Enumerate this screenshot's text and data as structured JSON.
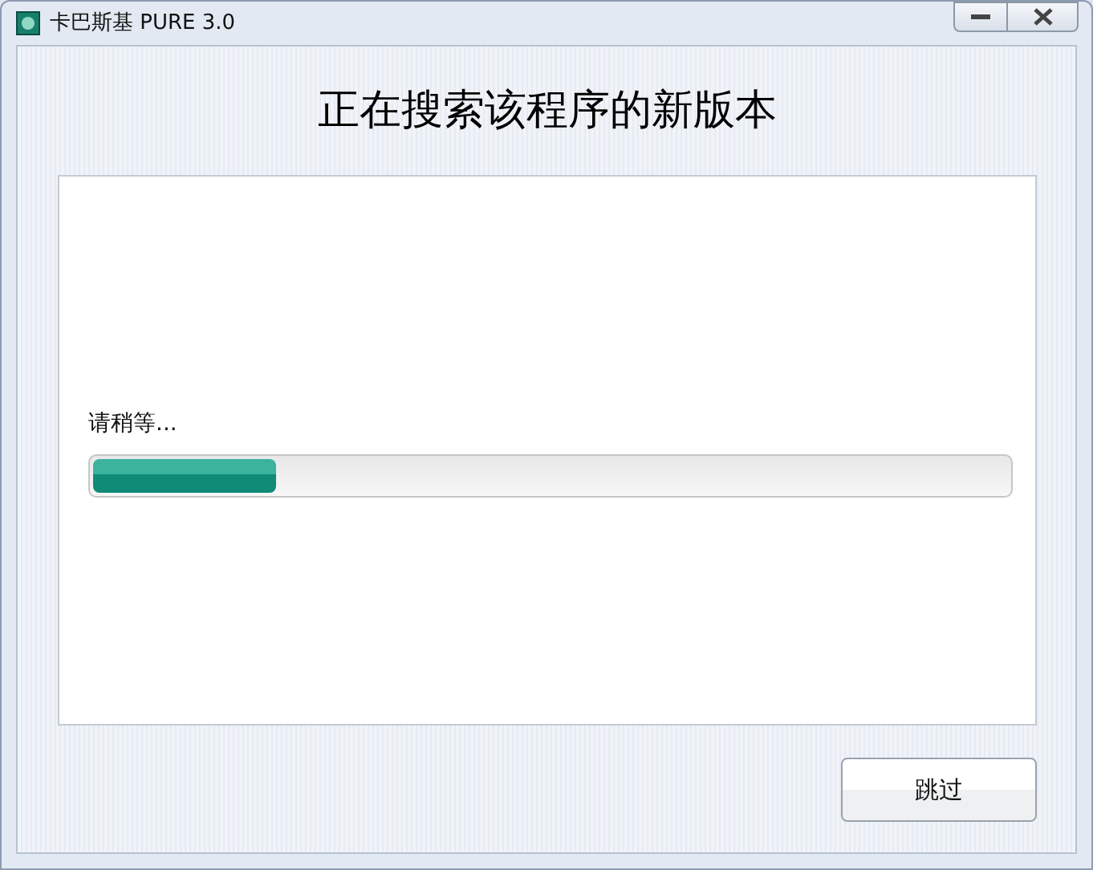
{
  "window": {
    "title": "卡巴斯基 PURE 3.0"
  },
  "heading": "正在搜索该程序的新版本",
  "status": "请稍等...",
  "progress": {
    "level": 0.2
  },
  "buttons": [
    {
      "label": "跳过"
    }
  ]
}
